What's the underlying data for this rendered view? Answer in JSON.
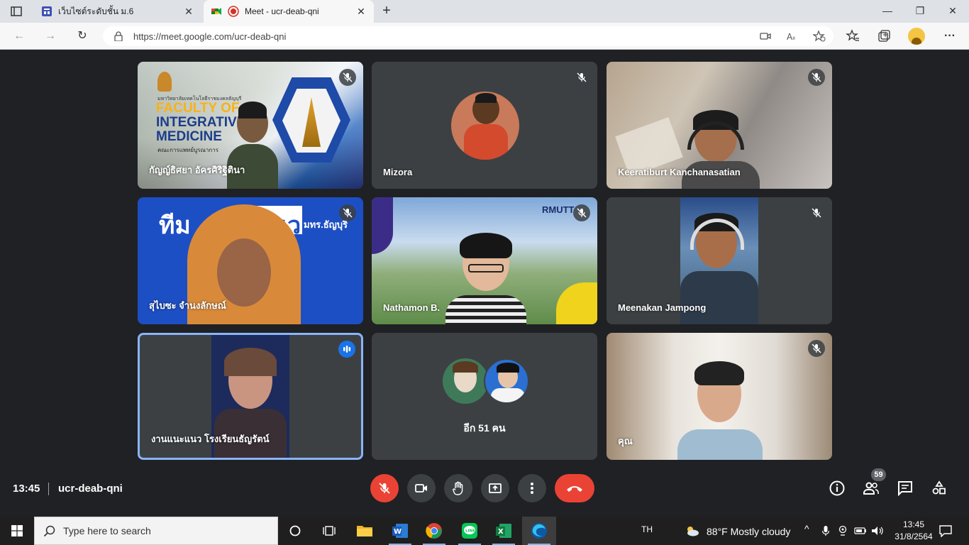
{
  "browser": {
    "tabs": [
      {
        "title": "เว็บไซต์ระดับชั้น ม.6",
        "active": false
      },
      {
        "title": "Meet - ucr-deab-qni",
        "active": true
      }
    ],
    "url": "https://meet.google.com/ucr-deab-qni"
  },
  "meet": {
    "time": "13:45",
    "meeting_code": "ucr-deab-qni",
    "participant_count": "59",
    "tiles": [
      {
        "name": "กัญญ์ธิศยา อัครศิริฐิตินา",
        "muted": true
      },
      {
        "name": "Mizora",
        "muted": true
      },
      {
        "name": "Keeratiburt Kanchanasatian",
        "muted": true
      },
      {
        "name": "สุไบซะ จำนงลักษณ์",
        "muted": true
      },
      {
        "name": "Nathamon B.",
        "muted": true
      },
      {
        "name": "Meenakan Jampong",
        "muted": true
      },
      {
        "name": "งานแนะแนว โรงเรียนธัญรัตน์",
        "muted": false,
        "speaking": true
      },
      {
        "name": "อีก 51 คน",
        "muted": false
      },
      {
        "name": "คุณ",
        "muted": true
      }
    ],
    "background_texts": {
      "faculty_line1": "FACULTY OF",
      "faculty_line2": "INTEGRATIVE",
      "faculty_line3": "MEDICINE",
      "faculty_thai": "คณะการแพทย์บูรณาการ",
      "university_thai": "มหาวิทยาลัยเทคโนโลยีราชมงคลธัญบุรี",
      "team_banner": "ทีม",
      "team_banner2": "แนว",
      "team_banner3": "มทร.ธัญบุรี",
      "rmutt_logo": "RMUTT"
    }
  },
  "taskbar": {
    "search_placeholder": "Type here to search",
    "language": "TH",
    "weather": "88°F  Mostly cloudy",
    "clock_time": "13:45",
    "clock_date": "31/8/2564"
  },
  "colors": {
    "meet_bg": "#202124",
    "tile_bg": "#3c4043",
    "red": "#ea4335",
    "active_border": "#8ab4f8"
  }
}
